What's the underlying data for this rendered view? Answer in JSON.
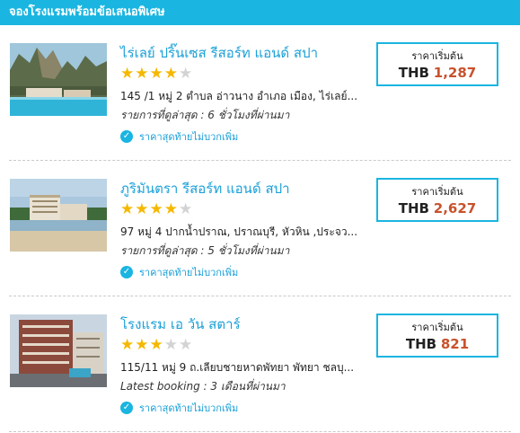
{
  "header": {
    "title": "จองโรงแรมพร้อมข้อเสนอพิเศษ"
  },
  "hotels": [
    {
      "name": "ไร่เลย์ ปริ๊นเซส รีสอร์ท แอนด์ สปา",
      "stars": 4,
      "address": "145 /1 หมู่ 2 ตำบล อ่าวนาง อำเภอ เมือง, ไร่เลย์...",
      "booking": "รายการที่ดูล่าสุด : 6 ชั่วโมงที่ผ่านมา",
      "note": "ราคาสุดท้ายไม่บวกเพิ่ม",
      "price_label": "ราคาเริ่มต้น",
      "currency": "THB",
      "price": "1,287"
    },
    {
      "name": "ภูริมันตรา รีสอร์ท แอนด์ สปา",
      "stars": 4,
      "address": "97 หมู่ 4 ปากน้ำปราณ, ปราณบุรี, หัวหิน ,ประจว...",
      "booking": "รายการที่ดูล่าสุด : 5 ชั่วโมงที่ผ่านมา",
      "note": "ราคาสุดท้ายไม่บวกเพิ่ม",
      "price_label": "ราคาเริ่มต้น",
      "currency": "THB",
      "price": "2,627"
    },
    {
      "name": "โรงแรม เอ วัน สตาร์",
      "stars": 3,
      "address": "115/11 หมู่ 9 ถ.เลียบชายหาดพัทยา พัทยา ชลบุ...",
      "booking": "Latest booking : 3 เดือนที่ผ่านมา",
      "note": "ราคาสุดท้ายไม่บวกเพิ่ม",
      "price_label": "ราคาเริ่มต้น",
      "currency": "THB",
      "price": "821"
    }
  ],
  "colors": {
    "accent": "#1ab5e0",
    "price": "#c8522c",
    "star": "#f5b800"
  },
  "icons": {
    "check": "check-circle-icon",
    "star": "star-icon"
  }
}
